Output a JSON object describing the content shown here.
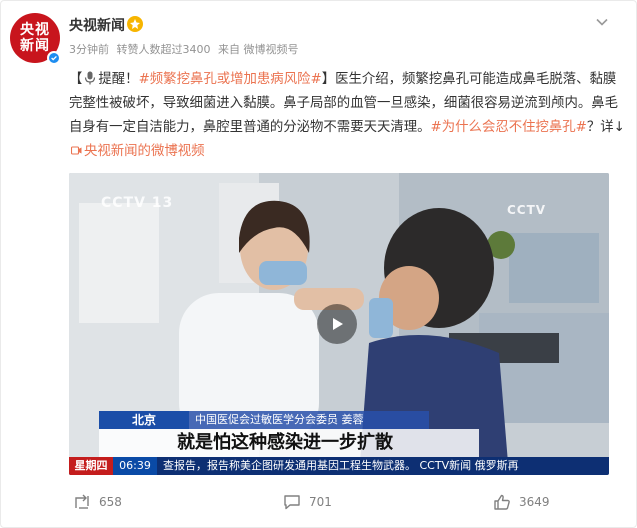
{
  "post": {
    "author": "央视新闻",
    "avatar_line1": "央视",
    "avatar_line2": "新闻",
    "meta_time": "3分钟前",
    "meta_reposts": "转赞人数超过3400",
    "meta_source": "来自 微博视频号",
    "text_open": "【",
    "text_remind": "提醒！",
    "tag_1": "#频繁挖鼻孔或增加患病风险#",
    "text_body": "】医生介绍，频繁挖鼻孔可能造成鼻毛脱落、黏膜完整性被破坏，导致细菌进入黏膜。鼻子局部的血管一旦感染，细菌很容易逆流到颅内。鼻毛自身有一定自洁能力，鼻腔里普通的分泌物不需要天天清理。",
    "tag_2": "#为什么会忍不住挖鼻孔#",
    "text_detail": "？详↓",
    "link_text": "央视新闻的微博视频"
  },
  "video": {
    "logo_left": "CCTV 13",
    "logo_right": "CCTV",
    "location": "北京",
    "speaker": "中国医促会过敏医学分会委员 姜蓉",
    "caption": "就是怕这种感染进一步扩散",
    "day": "星期四",
    "time": "06:39",
    "ticker": "查报告，报告称美企图研发通用基因工程生物武器。  CCTV新闻  俄罗斯再"
  },
  "actions": {
    "repost_count": "658",
    "comment_count": "701",
    "like_count": "3649"
  },
  "colors": {
    "tag": "#eb7350",
    "avatar_bg": "#c8151d",
    "meta": "#939393"
  }
}
